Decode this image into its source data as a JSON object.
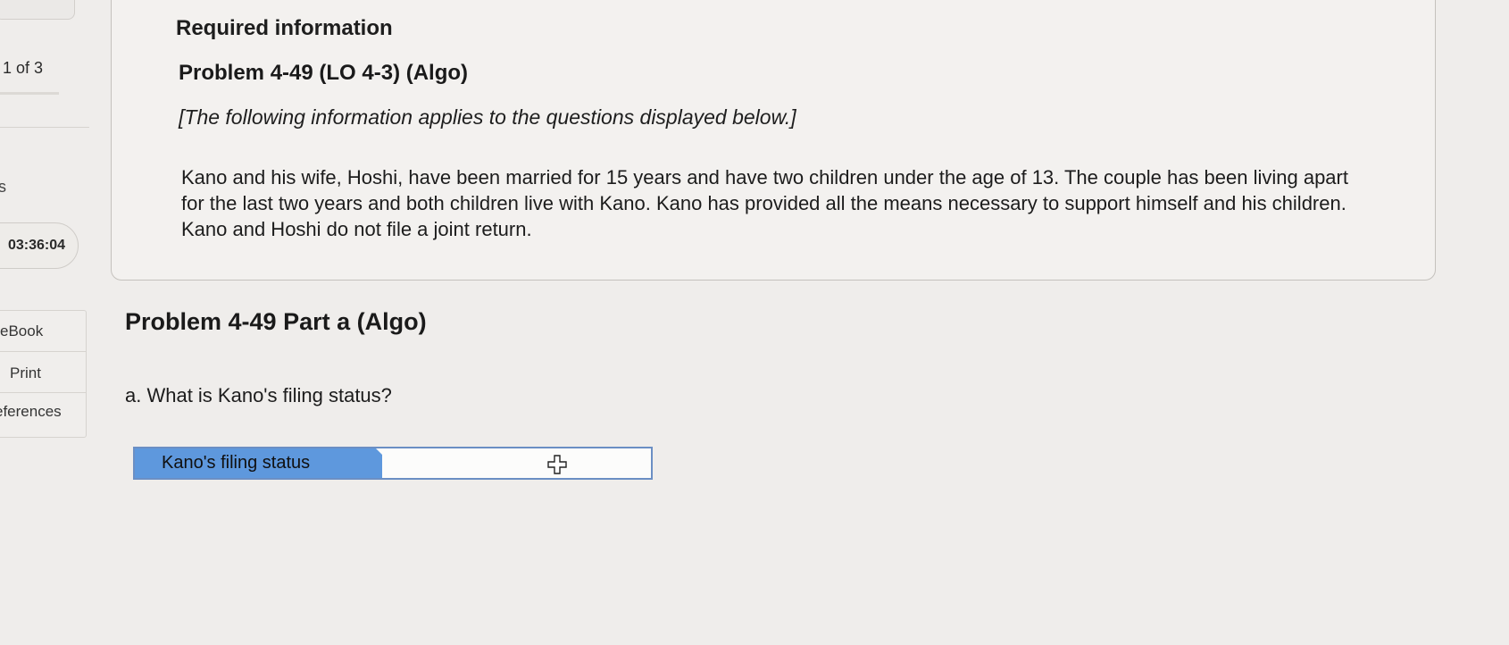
{
  "sidebar": {
    "counter": "1 of 3",
    "fragment": "s",
    "timer": "03:36:04",
    "tools": [
      "eBook",
      "Print",
      "eferences"
    ]
  },
  "info_card": {
    "heading": "Required information",
    "problem_title": "Problem 4-49 (LO 4-3) (Algo)",
    "intro_note": "[The following information applies to the questions displayed below.]",
    "scenario": "Kano and his wife, Hoshi, have been married for 15 years and have two children under the age of 13. The couple has been living apart for the last two years and both children live with Kano. Kano has provided all the means necessary to support himself and his children. Kano and Hoshi do not file a joint return."
  },
  "part": {
    "title": "Problem 4-49 Part a (Algo)",
    "question": "a. What is Kano's filing status?",
    "answer_label": "Kano's filing status",
    "answer_value": ""
  },
  "icons": {
    "cursor": "move-cross-icon"
  },
  "colors": {
    "label_background": "#5e98dd",
    "field_border": "#6b8fc4"
  }
}
